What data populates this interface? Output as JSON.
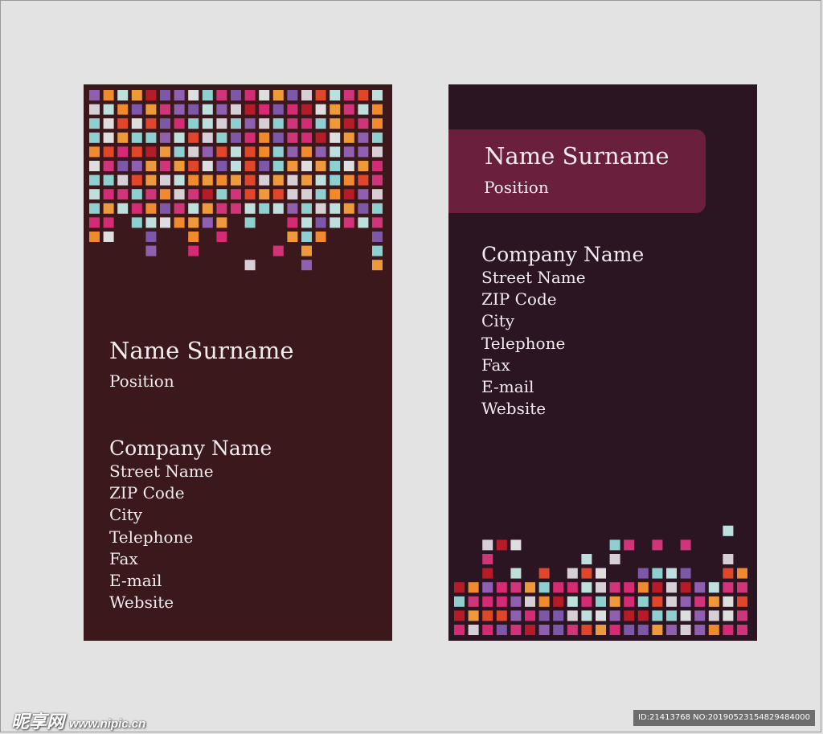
{
  "colors": {
    "background": "#e3e3e3",
    "left_card": "#3a181b",
    "right_card": "#2b1523",
    "banner": "#6a1f3c",
    "text": "#f3ecef",
    "tiles": [
      "#b51c27",
      "#e0462a",
      "#f08a2c",
      "#ee9a3a",
      "#d42b74",
      "#cf3578",
      "#7e58a8",
      "#8f5fb0",
      "#8ecfd0",
      "#bde0dd",
      "#dedede",
      "#d6d0d6"
    ]
  },
  "left_card": {
    "name": "Name Surname",
    "position": "Position",
    "company": "Company Name",
    "lines": [
      "Street Name",
      "ZIP Code",
      "City",
      "Telephone",
      "Fax",
      "E-mail",
      "Website"
    ]
  },
  "right_card": {
    "name": "Name Surname",
    "position": "Position",
    "company": "Company Name",
    "lines": [
      "Street Name",
      "ZIP Code",
      "City",
      "Telephone",
      "Fax",
      "E-mail",
      "Website"
    ]
  },
  "watermark": {
    "brand": "昵享网",
    "site": "www.nipic.cn",
    "id_text": "ID:21413768 NO:20190523154829484000"
  }
}
